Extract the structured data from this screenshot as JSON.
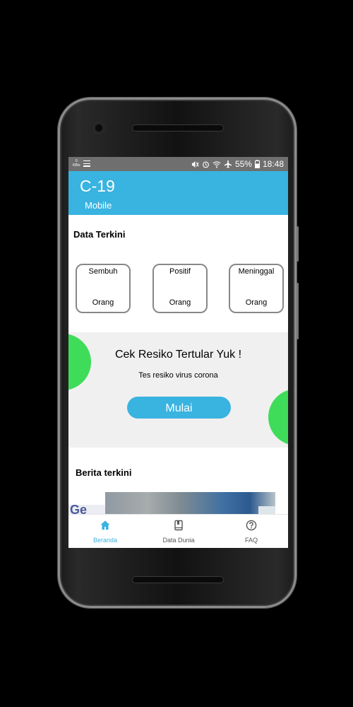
{
  "status_bar": {
    "net_speed_value": "0",
    "net_speed_unit": "KB/s",
    "battery": "55%",
    "time": "18:48"
  },
  "app_bar": {
    "title": "C-19",
    "subtitle": "Mobile",
    "color": "#39b3e0"
  },
  "data_section": {
    "title": "Data Terkini",
    "cards": [
      {
        "label": "Sembuh",
        "unit": "Orang"
      },
      {
        "label": "Positif",
        "unit": "Orang"
      },
      {
        "label": "Meninggal",
        "unit": "Orang"
      }
    ]
  },
  "risk_banner": {
    "title": "Cek Resiko Tertular Yuk !",
    "subtitle": "Tes resiko virus corona",
    "button_label": "Mulai",
    "blob_color": "#3fdc5a"
  },
  "news_section": {
    "title": "Berita terkini",
    "thumb_text": "Ge"
  },
  "bottom_nav": {
    "items": [
      {
        "label": "Beranda",
        "icon": "home-icon",
        "active": true
      },
      {
        "label": "Data Dunia",
        "icon": "book-icon",
        "active": false
      },
      {
        "label": "FAQ",
        "icon": "help-circle-icon",
        "active": false
      }
    ],
    "active_color": "#39b3e0",
    "inactive_color": "#555555"
  }
}
